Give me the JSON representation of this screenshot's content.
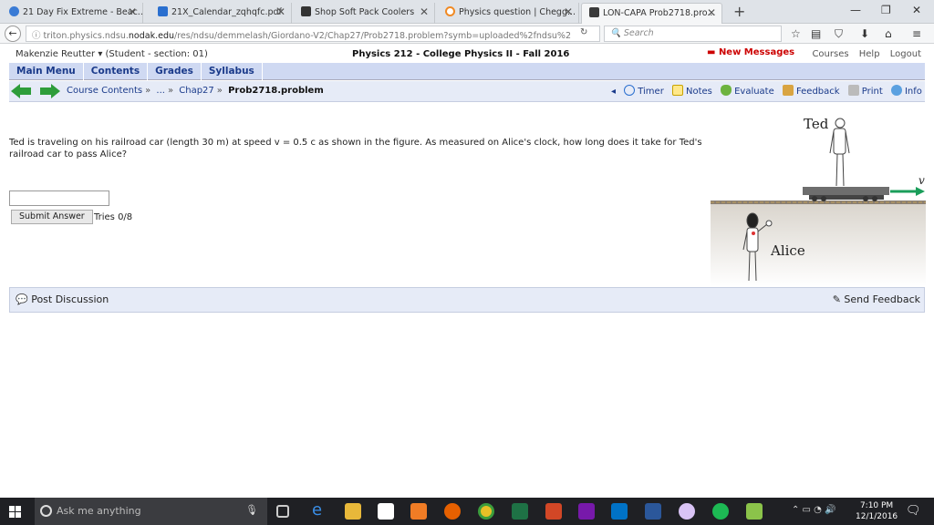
{
  "browser": {
    "tabs": [
      {
        "title": "21 Day Fix Extreme - Beac...",
        "color": "#3a7bd5"
      },
      {
        "title": "21X_Calendar_zqhqfc.pdf",
        "color": "#2a6fcf"
      },
      {
        "title": "Shop Soft Pack Coolers",
        "color": "#333333"
      },
      {
        "title": "Physics question | Chegg...",
        "color": "#f08a24"
      },
      {
        "title": "LON-CAPA Prob2718.pro...",
        "color": "#3a3a3a"
      }
    ],
    "url_prefix": "triton.physics.ndsu.",
    "url_domain": "nodak.edu",
    "url_rest": "/res/ndsu/demmelash/Giordano-V2/Chap27/Prob2718.problem?symb=uploaded%2fndsu%2",
    "search_placeholder": "Search"
  },
  "userbar": {
    "user": "Makenzie Reutter ▾ (Student - section: 01)",
    "course": "Physics 212 - College Physics II - Fall 2016",
    "messages": "New Messages",
    "links": [
      "Courses",
      "Help",
      "Logout"
    ]
  },
  "menu": [
    "Main Menu",
    "Contents",
    "Grades",
    "Syllabus"
  ],
  "breadcrumbs": {
    "items": [
      "Course Contents",
      "...",
      "Chap27"
    ],
    "current": "Prob2718.problem"
  },
  "tools": [
    "Timer",
    "Notes",
    "Evaluate",
    "Feedback",
    "Print",
    "Info"
  ],
  "problem": {
    "text": "Ted is traveling on his railroad car (length 30 m) at speed v = 0.5 c as shown in the figure. As measured on Alice's clock, how long does it take for Ted's railroad car to pass Alice?",
    "answer_value": "",
    "submit_label": "Submit Answer",
    "tries": "Tries 0/8"
  },
  "figure": {
    "ted_label": "Ted",
    "alice_label": "Alice",
    "velocity_label": "v"
  },
  "discussion": {
    "post": "Post Discussion",
    "feedback": "Send Feedback"
  },
  "taskbar": {
    "search_placeholder": "Ask me anything",
    "time": "7:10 PM",
    "date": "12/1/2016"
  },
  "colors": {
    "menu_bg": "#cfd9f2",
    "link": "#1a3a8a",
    "alert": "#cc0000",
    "arrow": "#2e9d3a"
  }
}
